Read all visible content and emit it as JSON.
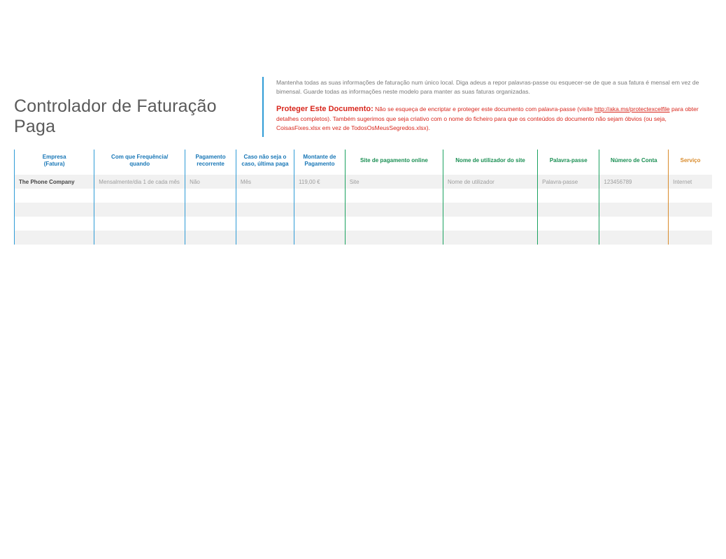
{
  "header": {
    "title": "Controlador de Faturação Paga",
    "description": "Mantenha todas as suas informações de faturação num único local. Diga adeus a repor palavras-passe ou esquecer-se de que a sua fatura é mensal em vez de bimensal. Guarde todas as informações neste modelo para manter as suas faturas organizadas.",
    "protect_title": "Proteger Este Documento:",
    "protect_prefix": "Não se esqueça de encriptar e proteger este documento com palavra-passe (visite ",
    "protect_link": "http://aka.ms/protectexcelfile",
    "protect_suffix": " para obter detalhes completos). Também sugerimos que seja criativo com o nome do ficheiro para que os conteúdos do documento não sejam óbvios (ou seja, CoisasFixes.xlsx em vez de TodosOsMeusSegredos.xlsx)."
  },
  "columns": {
    "empresa": "Empresa\n(Fatura)",
    "frequencia": "Com que Frequência/\nquando",
    "recorrente": "Pagamento\nrecorrente",
    "ultima": "Caso não seja o\ncaso, última paga",
    "montante": "Montante de\nPagamento",
    "site": "Site de pagamento online",
    "utilizador": "Nome de utilizador do site",
    "palavra": "Palavra-passe",
    "conta": "Número de Conta",
    "servico": "Serviço"
  },
  "rows": [
    {
      "empresa": "The Phone Company",
      "frequencia": "Mensalmente/dia 1 de cada mês",
      "recorrente": "Não",
      "ultima": "Mês",
      "montante": "119,00 €",
      "site": "Site",
      "utilizador": "Nome de utilizador",
      "palavra": "Palavra-passe",
      "conta": "123456789",
      "servico": "Internet"
    }
  ]
}
